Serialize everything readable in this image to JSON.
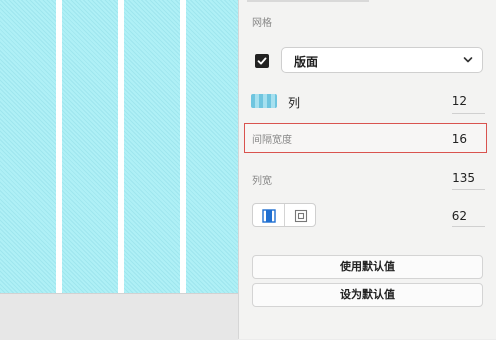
{
  "panel": {
    "section_title": "网格",
    "layout": {
      "checked": true,
      "select_value": "版面"
    },
    "columns": {
      "label": "列",
      "value": "12"
    },
    "gutter_width": {
      "label": "间隔宽度",
      "value": "16"
    },
    "column_width": {
      "label": "列宽",
      "value": "135"
    },
    "alignment": {
      "value": "62"
    },
    "buttons": {
      "use_default": "使用默认值",
      "set_default": "设为默认值"
    }
  },
  "colors": {
    "artboard": "#a8ecf3",
    "highlight": "#d9534f"
  }
}
